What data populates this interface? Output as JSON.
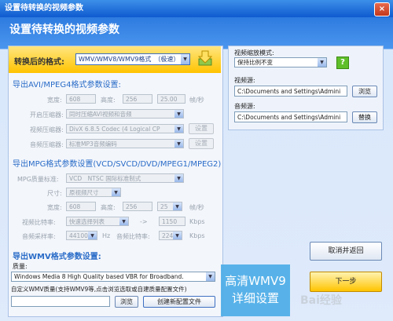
{
  "window": {
    "title": "设置待转换的视频参数",
    "header": "设置待转换的视频参数",
    "close_glyph": "×"
  },
  "format": {
    "label": "转换后的格式:",
    "value": "WMV/WMV8/WMV9格式　（极速）"
  },
  "avi": {
    "title": "导出AVI/MPEG4格式参数设置:",
    "width_label": "宽度:",
    "width": "608",
    "height_label": "高度:",
    "height": "256",
    "fps": "25.00",
    "fps_unit": "帧/秒",
    "compressor_label": "开启压缩器:",
    "compressor": "同时压缩AVI视频和音频",
    "video_codec_label": "视频压缩器:",
    "video_codec": "DivX 6.8.5 Codec (4 Logical CP",
    "audio_codec_label": "音频压缩器:",
    "audio_codec": "标准MP3音频编码",
    "settings_label": "设置"
  },
  "mpg": {
    "title": "导出MPG格式参数设置(VCD/SVCD/DVD/MPEG1/MPEG2)",
    "quality_label": "MPG质量标准:",
    "quality": "VCD　NTSC 国际标准制式",
    "size_label": "尺寸:",
    "size": "原视频尺寸",
    "width_label": "宽度:",
    "width": "608",
    "height_label": "高度:",
    "height": "256",
    "fps": "25",
    "fps_unit": "帧/秒",
    "vbitrate_label": "视频比特率:",
    "vbitrate": "快速选择列表",
    "arrow": "->",
    "vbitrate_value": "1150",
    "vbitrate_unit": "Kbps",
    "samplerate_label": "音频采样率:",
    "samplerate": "44100",
    "hz": "Hz",
    "abitrate_label": "音频比特率:",
    "abitrate": "224",
    "kbps": "Kbps"
  },
  "wmv": {
    "title": "导出WMV格式参数设置:",
    "quality_label": "质量:",
    "quality": "Windows Media 8 High Quality based VBR for Broadband.",
    "custom_label": "自定义WMV质量(支持WMV9等,点击浏览选取或自建质量配置文件)",
    "browse_label": "浏览",
    "create_label": "创建新配置文件"
  },
  "right": {
    "scale_label": "视频缩放模式:",
    "scale": "保持比例不变",
    "video_source_label": "视频源:",
    "video_source": "C:\\Documents and Settings\\Admini",
    "browse_label": "浏览",
    "audio_source_label": "音频源:",
    "audio_source": "C:\\Documents and Settings\\Admini",
    "replace_label": "替换",
    "help_glyph": "?"
  },
  "actions": {
    "cancel_label": "取消并返回",
    "next_label": "下一步"
  },
  "overlay": {
    "line1": "高清WMV9",
    "line2": "详细设置"
  },
  "watermark": "Bai经验"
}
